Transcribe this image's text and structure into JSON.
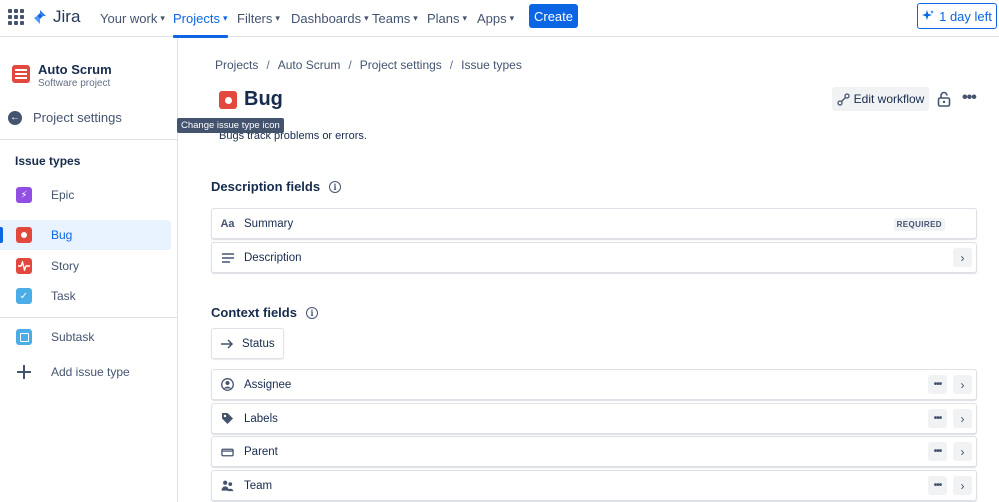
{
  "topnav": {
    "logo_text": "Jira",
    "items": [
      {
        "label": "Your work"
      },
      {
        "label": "Projects"
      },
      {
        "label": "Filters"
      },
      {
        "label": "Dashboards"
      },
      {
        "label": "Teams"
      },
      {
        "label": "Plans"
      },
      {
        "label": "Apps"
      }
    ],
    "active_item": "Projects",
    "create_label": "Create",
    "trial_label": "1 day left",
    "accent_color": "#0c66e4"
  },
  "sidebar": {
    "project_name": "Auto Scrum",
    "project_type": "Software project",
    "back_label": "Project settings",
    "section_heading": "Issue types",
    "items": [
      {
        "label": "Epic",
        "icon": "epic-icon"
      },
      {
        "label": "Bug",
        "icon": "bug-icon",
        "selected": true
      },
      {
        "label": "Story",
        "icon": "story-icon"
      },
      {
        "label": "Task",
        "icon": "task-icon"
      },
      {
        "label": "Subtask",
        "icon": "subtask-icon"
      }
    ],
    "add_label": "Add issue type"
  },
  "breadcrumb": [
    "Projects",
    "Auto Scrum",
    "Project settings",
    "Issue types"
  ],
  "page": {
    "title": "Bug",
    "tooltip": "Change issue type icon",
    "description": "Bugs track problems or errors.",
    "edit_workflow_label": "Edit workflow"
  },
  "description_fields": {
    "title": "Description fields",
    "fields": [
      {
        "label": "Summary",
        "icon": "text-style-icon",
        "badge": "REQUIRED"
      },
      {
        "label": "Description",
        "icon": "lines-icon"
      }
    ]
  },
  "context_fields": {
    "title": "Context fields",
    "status_label": "Status",
    "fields": [
      {
        "label": "Assignee",
        "icon": "person-icon"
      },
      {
        "label": "Labels",
        "icon": "tag-icon"
      },
      {
        "label": "Parent",
        "icon": "parent-icon"
      },
      {
        "label": "Team",
        "icon": "people-icon"
      }
    ]
  }
}
